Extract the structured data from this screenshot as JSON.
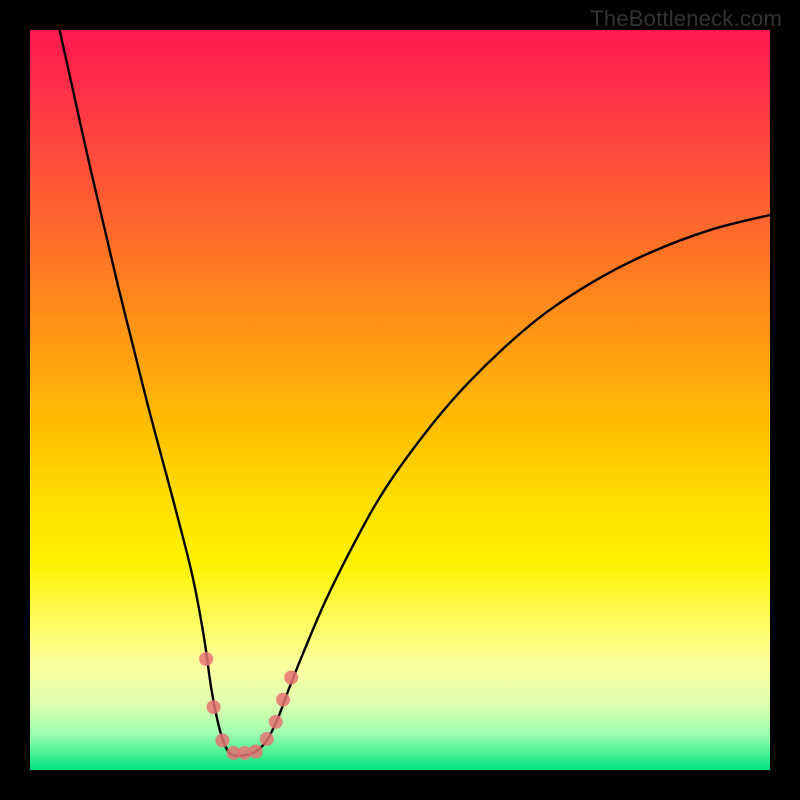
{
  "watermark": "TheBottleneck.com",
  "colors": {
    "curve": "#000000",
    "dot": "#e57373"
  },
  "chart_data": {
    "type": "line",
    "title": "",
    "xlabel": "",
    "ylabel": "",
    "xlim": [
      0,
      100
    ],
    "ylim": [
      0,
      100
    ],
    "grid": false,
    "legend": false,
    "background": "vertical gradient red→yellow→green (high→low)",
    "curve": {
      "description": "Asymmetric V-shaped bottleneck curve",
      "min_x": 27.5,
      "min_y": 2,
      "left_top": {
        "x": 4,
        "y": 100
      },
      "right_top": {
        "x": 100,
        "y": 75
      },
      "points_xy": [
        [
          4.0,
          100.0
        ],
        [
          6.0,
          91.0
        ],
        [
          8.0,
          82.0
        ],
        [
          10.0,
          73.5
        ],
        [
          12.0,
          65.0
        ],
        [
          14.0,
          57.0
        ],
        [
          16.0,
          49.0
        ],
        [
          18.0,
          41.5
        ],
        [
          20.0,
          34.0
        ],
        [
          22.0,
          26.0
        ],
        [
          23.5,
          18.0
        ],
        [
          24.5,
          11.0
        ],
        [
          25.5,
          6.0
        ],
        [
          26.5,
          3.0
        ],
        [
          27.5,
          2.0
        ],
        [
          29.0,
          2.0
        ],
        [
          30.5,
          2.5
        ],
        [
          32.0,
          4.0
        ],
        [
          33.5,
          7.0
        ],
        [
          35.0,
          11.0
        ],
        [
          37.0,
          16.0
        ],
        [
          40.0,
          23.0
        ],
        [
          44.0,
          31.0
        ],
        [
          48.0,
          38.0
        ],
        [
          53.0,
          45.0
        ],
        [
          58.0,
          51.0
        ],
        [
          64.0,
          57.0
        ],
        [
          70.0,
          62.0
        ],
        [
          77.0,
          66.5
        ],
        [
          84.0,
          70.0
        ],
        [
          92.0,
          73.0
        ],
        [
          100.0,
          75.0
        ]
      ]
    },
    "dots_xy": [
      [
        23.8,
        15.0
      ],
      [
        24.8,
        8.5
      ],
      [
        26.0,
        4.0
      ],
      [
        27.5,
        2.3
      ],
      [
        29.0,
        2.3
      ],
      [
        30.5,
        2.5
      ],
      [
        32.0,
        4.2
      ],
      [
        33.2,
        6.5
      ],
      [
        34.2,
        9.5
      ],
      [
        35.3,
        12.5
      ]
    ]
  }
}
